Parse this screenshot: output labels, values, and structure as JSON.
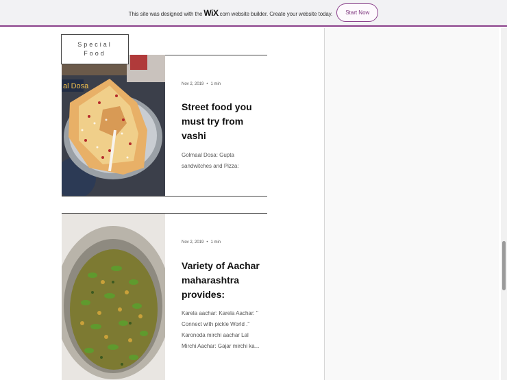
{
  "banner": {
    "text_before": "This site was designed with the ",
    "logo": "WiX",
    "text_after": ".com website builder. Create your website today.",
    "cta_label": "Start Now"
  },
  "category": {
    "line1": "Special",
    "line2": "Food"
  },
  "posts": [
    {
      "date": "Nov 2, 2019",
      "separator": "•",
      "read_time": "1 min",
      "title": "Street food you must try from vashi",
      "excerpt": "Golmaal Dosa: Gupta sandwitches and Pizza:",
      "image_caption": "al Dosa"
    },
    {
      "date": "Nov 2, 2019",
      "separator": "•",
      "read_time": "1 min",
      "title": "Variety of Aachar maharashtra provides:",
      "excerpt": "Karela aachar: Karela Aachar: \" Connect with pickle World .\" Karonoda mirchi aachar Lal Mirchi Aachar: Gajar mirchi ka..."
    }
  ],
  "colors": {
    "accent": "#8a3f8a",
    "rule": "#444444"
  }
}
